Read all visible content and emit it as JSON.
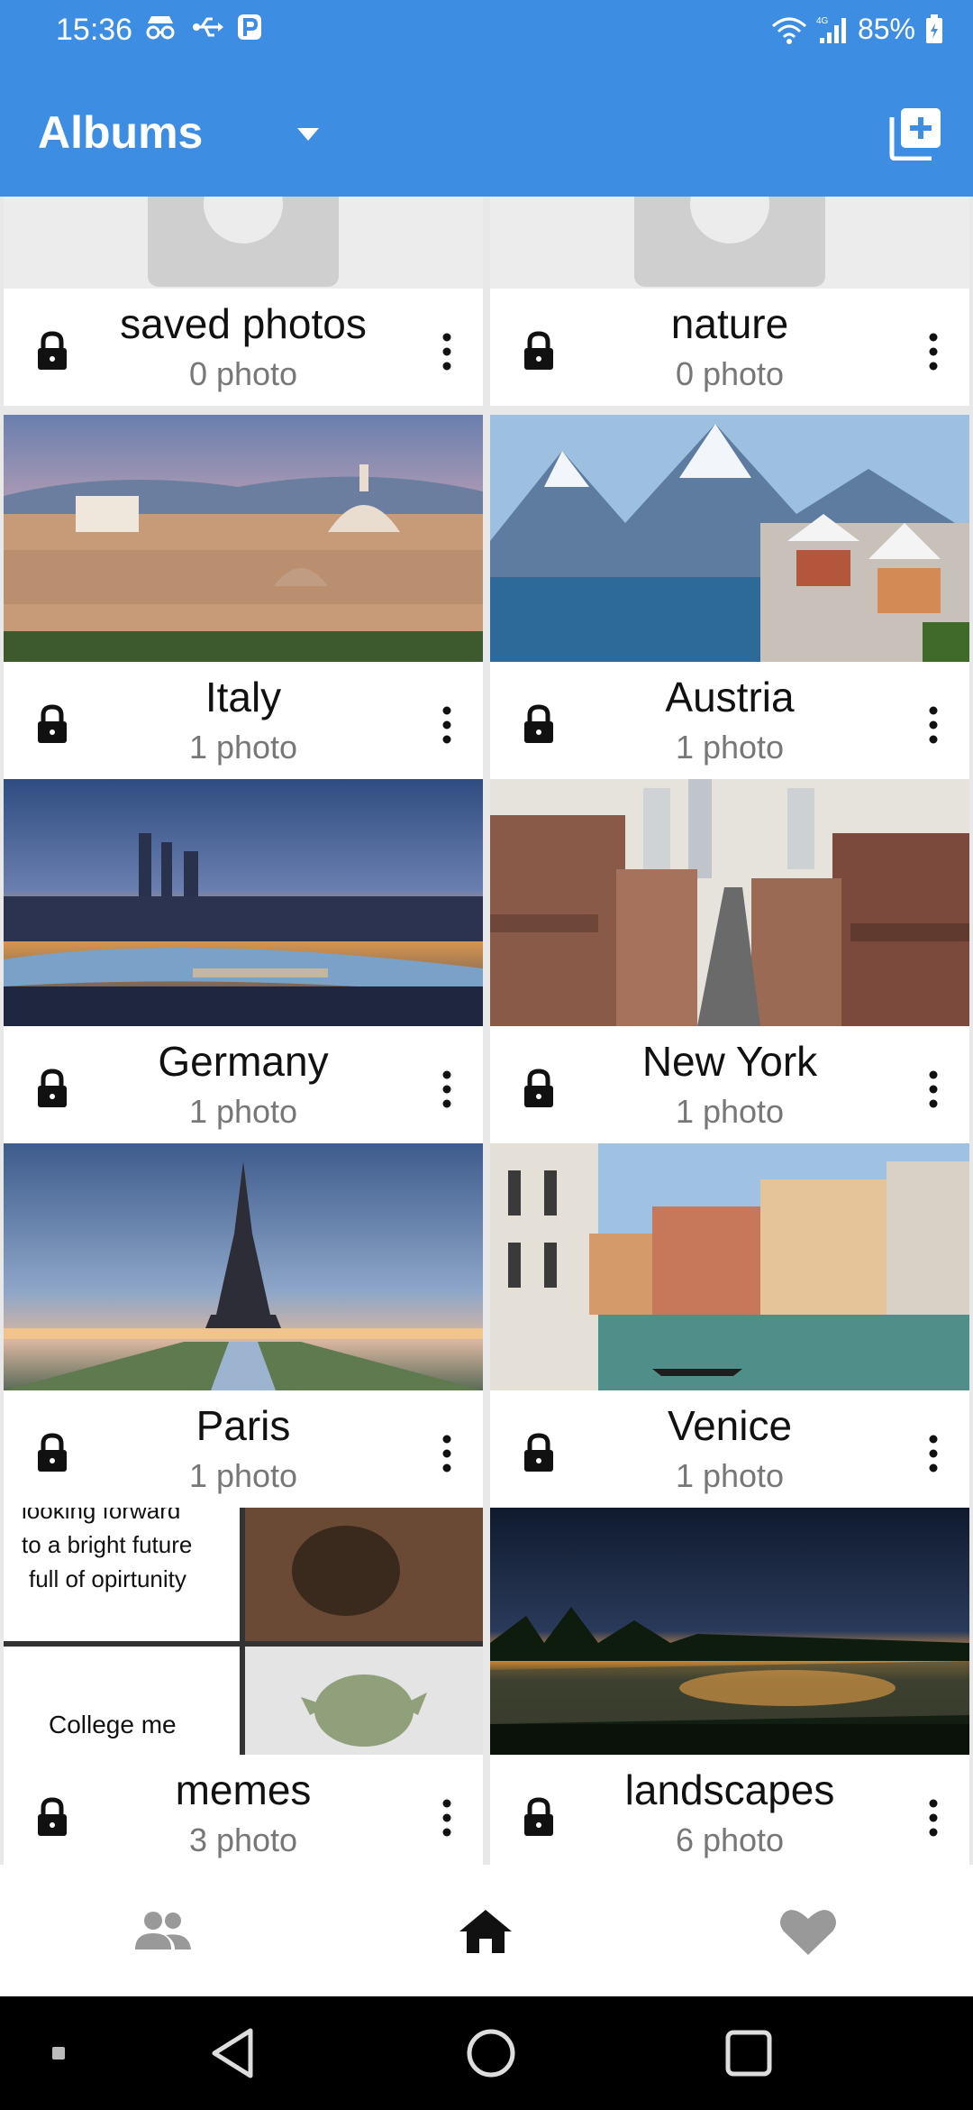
{
  "status_bar": {
    "time": "15:36",
    "battery_percent": "85%",
    "icons_left": [
      "incognito-icon",
      "usb-icon",
      "parking-icon"
    ],
    "icons_right": [
      "wifi-icon",
      "signal-4g-icon",
      "battery-icon"
    ]
  },
  "app_bar": {
    "title": "Albums",
    "dropdown_icon": "arrow-drop-down-icon",
    "add_button_icon": "add-album-icon"
  },
  "albums": [
    {
      "name": "saved photos",
      "count": "0 photo"
    },
    {
      "name": "nature",
      "count": "0 photo"
    },
    {
      "name": "Italy",
      "count": "1 photo"
    },
    {
      "name": "Austria",
      "count": "1 photo"
    },
    {
      "name": "Germany",
      "count": "1 photo"
    },
    {
      "name": "New York",
      "count": "1 photo"
    },
    {
      "name": "Paris",
      "count": "1 photo"
    },
    {
      "name": "Venice",
      "count": "1 photo"
    },
    {
      "name": "memes",
      "count": "3 photo",
      "thumb_text": {
        "top_line1": "looking forward",
        "top_line2": "to a bright future",
        "top_line3": "full of opirtunity",
        "bottom": "College me"
      }
    },
    {
      "name": "landscapes",
      "count": "6 photo"
    }
  ],
  "bottom_nav": {
    "items": [
      "people-icon",
      "home-icon",
      "favorite-icon"
    ],
    "active": "home-icon"
  },
  "colors": {
    "app_bar": "#3d8ee2",
    "background": "#e8e8e8"
  }
}
